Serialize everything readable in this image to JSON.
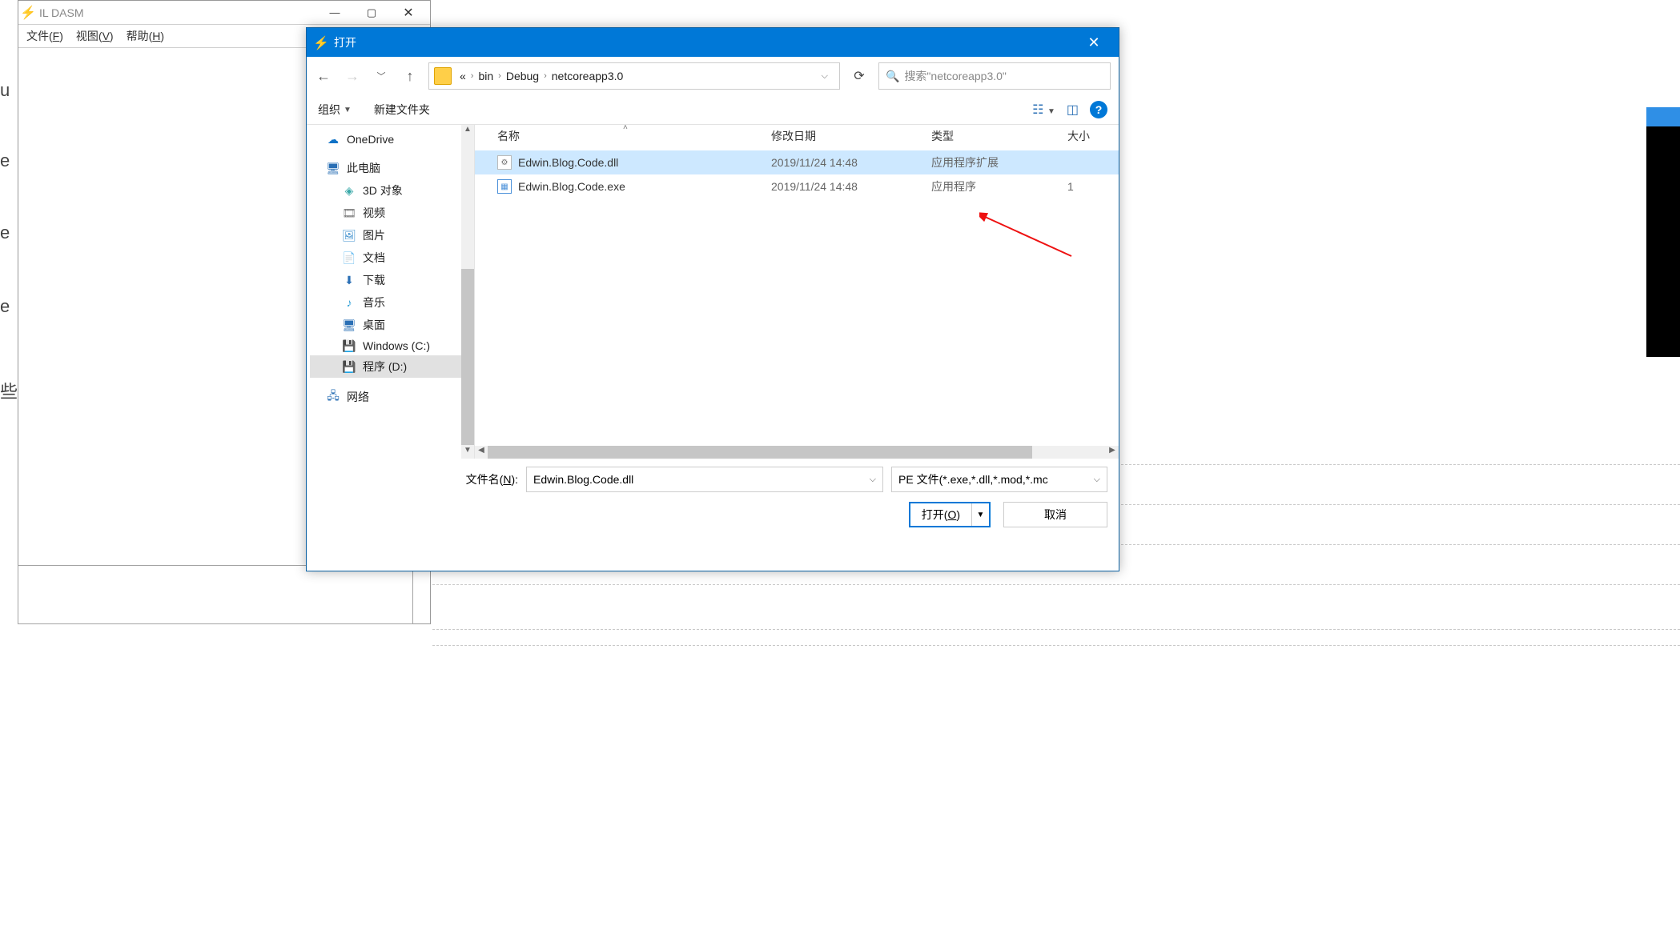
{
  "ildasm": {
    "title": "IL DASM",
    "menu": {
      "file": "文件(F)",
      "view": "视图(V)",
      "help": "帮助(H)"
    }
  },
  "bgtext": {
    "t1": "u",
    "t2": "e",
    "t3": "e",
    "t4": "e",
    "t5": "些迄"
  },
  "dialog": {
    "title": "打开",
    "breadcrumb": {
      "prefix": "«",
      "p1": "bin",
      "p2": "Debug",
      "p3": "netcoreapp3.0"
    },
    "search_placeholder": "搜索\"netcoreapp3.0\"",
    "toolbar": {
      "organize": "组织",
      "newfolder": "新建文件夹"
    },
    "tree": {
      "onedrive": "OneDrive",
      "thispc": "此电脑",
      "obj3d": "3D 对象",
      "video": "视频",
      "pictures": "图片",
      "docs": "文档",
      "downloads": "下载",
      "music": "音乐",
      "desktop": "桌面",
      "cdrive": "Windows (C:)",
      "ddrive": "程序 (D:)",
      "network": "网络"
    },
    "cols": {
      "name": "名称",
      "date": "修改日期",
      "type": "类型",
      "size": "大小"
    },
    "files": [
      {
        "name": "Edwin.Blog.Code.dll",
        "date": "2019/11/24 14:48",
        "type": "应用程序扩展",
        "size": ""
      },
      {
        "name": "Edwin.Blog.Code.exe",
        "date": "2019/11/24 14:48",
        "type": "应用程序",
        "size": "1"
      }
    ],
    "footer": {
      "filename_label": "文件名(N):",
      "filename_value": "Edwin.Blog.Code.dll",
      "filter": "PE 文件(*.exe,*.dll,*.mod,*.mc",
      "open": "打开(O)",
      "cancel": "取消"
    }
  }
}
